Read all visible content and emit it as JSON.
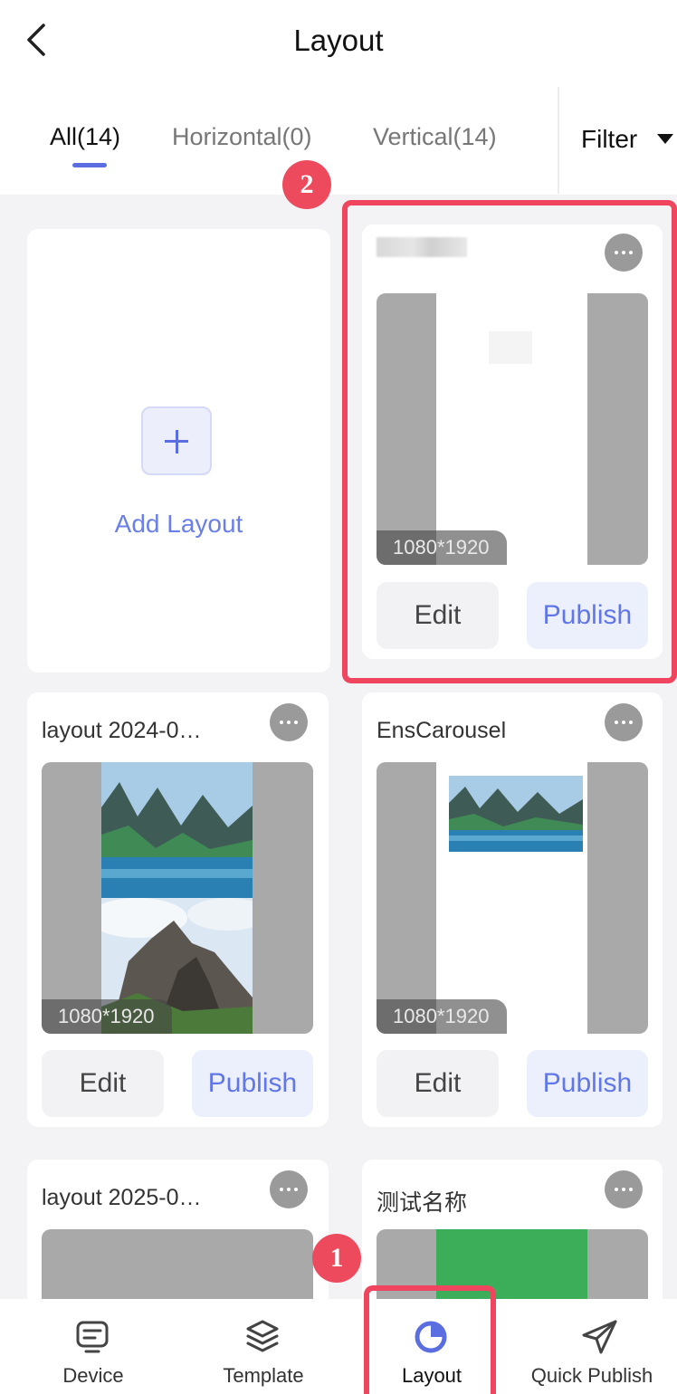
{
  "header": {
    "title": "Layout"
  },
  "tabs": [
    {
      "label": "All(14)",
      "active": true
    },
    {
      "label": "Horizontal(0)",
      "active": false
    },
    {
      "label": "Vertical(14)",
      "active": false
    }
  ],
  "tab_separator": "⋮",
  "filter": {
    "label": "Filter"
  },
  "add_card": {
    "label": "Add Layout",
    "icon": "plus-icon"
  },
  "layouts": [
    {
      "title": "",
      "resolution": "1080*1920",
      "edit_label": "Edit",
      "publish_label": "Publish"
    },
    {
      "title": "layout 2024-0…",
      "resolution": "1080*1920",
      "edit_label": "Edit",
      "publish_label": "Publish"
    },
    {
      "title": "EnsCarousel",
      "resolution": "1080*1920",
      "edit_label": "Edit",
      "publish_label": "Publish"
    },
    {
      "title": "layout 2025-0…",
      "resolution": "",
      "edit_label": "",
      "publish_label": ""
    },
    {
      "title": "测试名称",
      "resolution": "",
      "edit_label": "",
      "publish_label": ""
    }
  ],
  "annotations": {
    "badge_1": "1",
    "badge_2": "2",
    "highlight_color": "#f0455f"
  },
  "bottom_nav": [
    {
      "label": "Device",
      "icon": "device-icon",
      "active": false
    },
    {
      "label": "Template",
      "icon": "layers-icon",
      "active": false
    },
    {
      "label": "Layout",
      "icon": "layout-icon",
      "active": true
    },
    {
      "label": "Quick Publish",
      "icon": "paper-plane-icon",
      "active": false
    }
  ],
  "colors": {
    "accent": "#5b6ee1",
    "publish_text": "#6177e8",
    "publish_bg": "#eceffc",
    "thumb_gray": "#a9a9a9"
  }
}
